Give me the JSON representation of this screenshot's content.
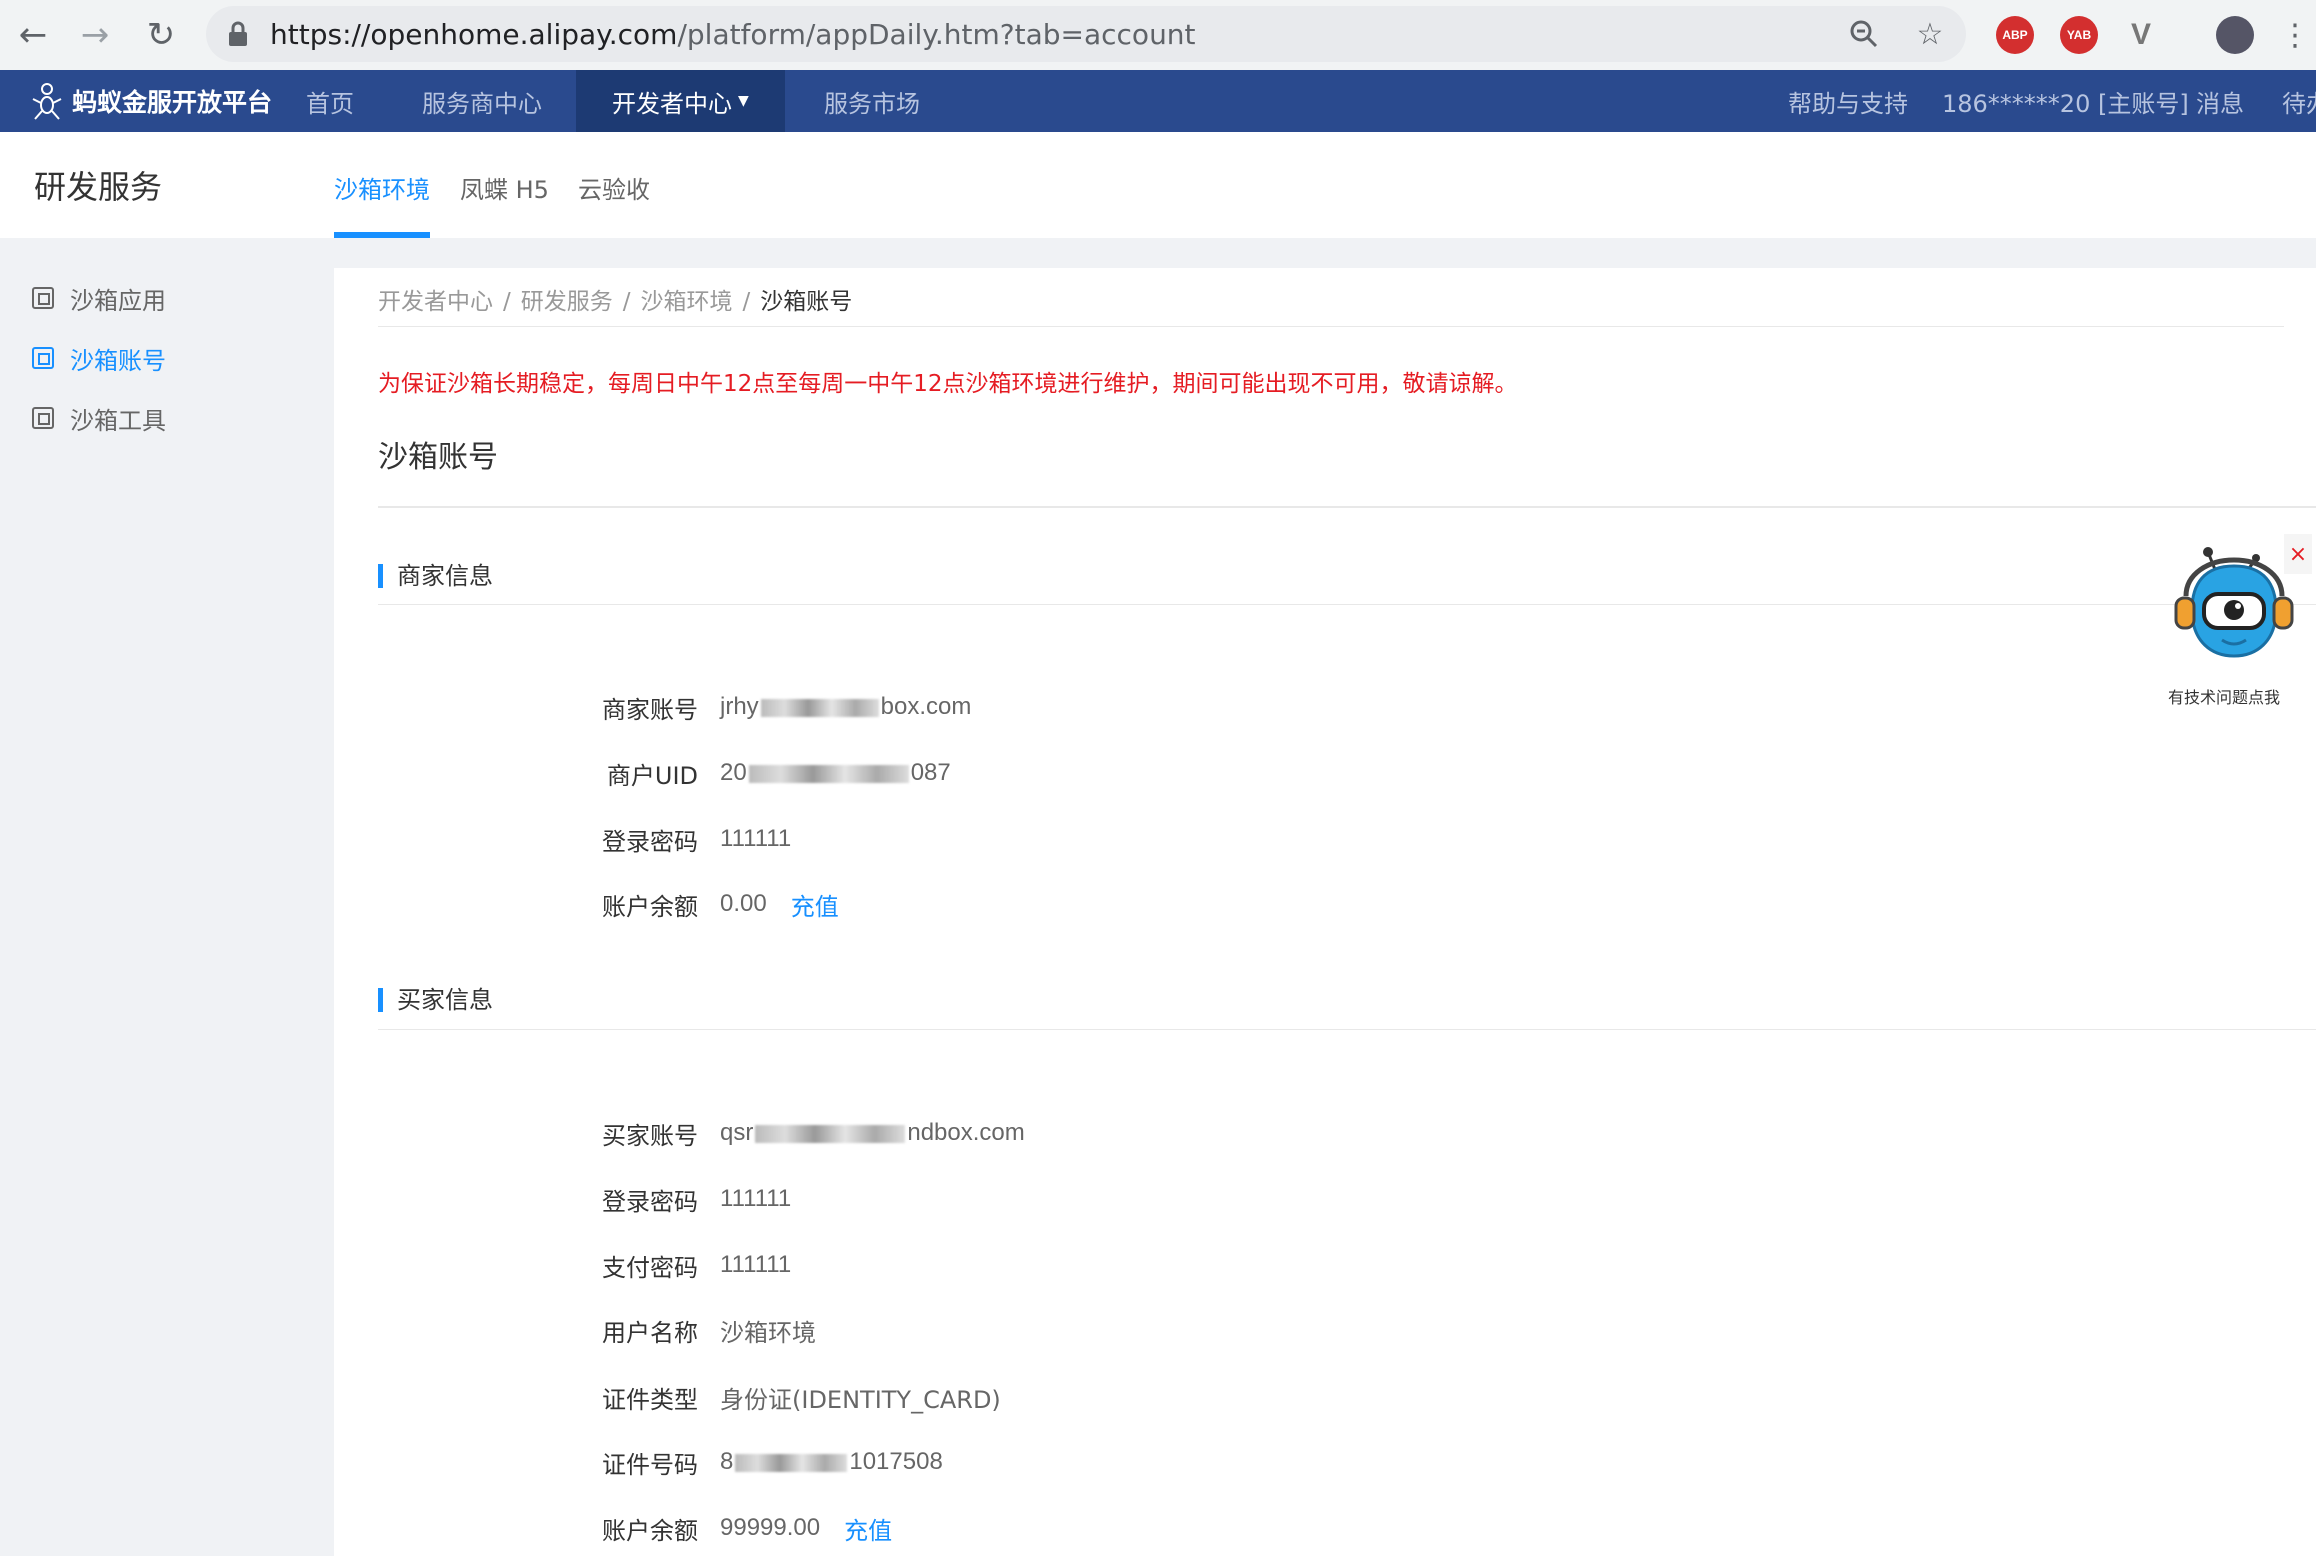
{
  "browser": {
    "url_host": "https://openhome.alipay.com",
    "url_path": "/platform/appDaily.htm?tab=account"
  },
  "topnav": {
    "logo": "蚂蚁金服开放平台",
    "items": [
      "首页",
      "服务商中心",
      "开发者中心",
      "服务市场"
    ],
    "right": [
      "帮助与支持",
      "186******20 [主账号]",
      "消息",
      "待办"
    ]
  },
  "subheader": {
    "title": "研发服务",
    "tabs": [
      "沙箱环境",
      "凤蝶 H5",
      "云验收"
    ]
  },
  "sidebar": {
    "items": [
      "沙箱应用",
      "沙箱账号",
      "沙箱工具"
    ]
  },
  "breadcrumb": [
    "开发者中心",
    "研发服务",
    "沙箱环境",
    "沙箱账号"
  ],
  "notice": "为保证沙箱长期稳定，每周日中午12点至每周一中午12点沙箱环境进行维护，期间可能出现不可用，敬请谅解。",
  "page_title": "沙箱账号",
  "merchant": {
    "title": "商家信息",
    "rows": [
      {
        "label": "商家账号",
        "prefix": "jrhy",
        "suffix": "box.com"
      },
      {
        "label": "商户UID",
        "prefix": "20",
        "suffix": "087"
      },
      {
        "label": "登录密码",
        "value": "111111"
      },
      {
        "label": "账户余额",
        "value": "0.00",
        "action": "充值"
      }
    ]
  },
  "buyer": {
    "title": "买家信息",
    "rows": [
      {
        "label": "买家账号",
        "prefix": "qsr",
        "suffix": "ndbox.com"
      },
      {
        "label": "登录密码",
        "value": "111111"
      },
      {
        "label": "支付密码",
        "value": "111111"
      },
      {
        "label": "用户名称",
        "value": "沙箱环境"
      },
      {
        "label": "证件类型",
        "value": "身份证(IDENTITY_CARD)"
      },
      {
        "label": "证件号码",
        "prefix": "8",
        "suffix": "1017508"
      },
      {
        "label": "账户余额",
        "value": "99999.00",
        "action": "充值"
      }
    ]
  },
  "bot": {
    "caption": "有技术问题点我",
    "close": "×"
  },
  "colors": {
    "nav_bg": "#2a4a8e",
    "accent": "#1890ff",
    "warning": "#e51c23"
  }
}
